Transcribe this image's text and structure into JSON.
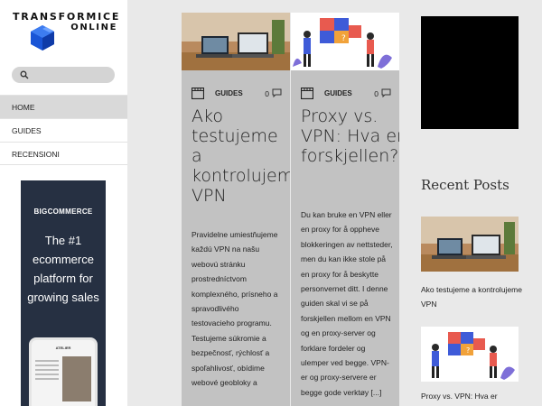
{
  "brand": {
    "line1": "TRANSFORMICE",
    "line2": "ONLINE"
  },
  "search": {
    "placeholder": ""
  },
  "nav": [
    {
      "label": "HOME",
      "active": true
    },
    {
      "label": "GUIDES",
      "active": false
    },
    {
      "label": "RECENSIONI",
      "active": false
    }
  ],
  "ad": {
    "brand_prefix": "BIG",
    "brand_rest": "COMMERCE",
    "text": "The #1 ecommerce platform for growing sales",
    "phone_label": "ATELIER"
  },
  "cards": [
    {
      "category": "GUIDES",
      "comments": "0",
      "title": "Ako testujeme a kontrolujeme VPN",
      "excerpt": "Pravidelne umiestňujeme každú VPN na našu webovú stránku prostredníctvom komplexného, prísneho a spravodlivého testovacieho programu. Testujeme súkromie a bezpečnosť, rýchlosť a spoľahlivosť, obídime webové geobloky a"
    },
    {
      "category": "GUIDES",
      "comments": "0",
      "title": "Proxy vs. VPN: Hva er forskjellen?",
      "excerpt": "Du kan bruke en VPN eller en proxy for å oppheve blokkeringen av nettsteder, men du kan ikke stole på en proxy for å beskytte personvernet ditt. I denne guiden skal vi se på forskjellen mellom en VPN og en proxy-server og forklare fordeler og ulemper ved begge. VPN-er og proxy-servere er begge gode verktøy [...]"
    }
  ],
  "recent": {
    "heading": "Recent Posts",
    "items": [
      {
        "title": "Ako testujeme a kontrolujeme VPN"
      },
      {
        "title": "Proxy vs. VPN: Hva er"
      }
    ]
  },
  "colors": {
    "ad_bg": "#263042",
    "logo_cube": "#1a55d6",
    "page_bg": "#e9e9e9",
    "card_bg": "#c2c2c2"
  }
}
